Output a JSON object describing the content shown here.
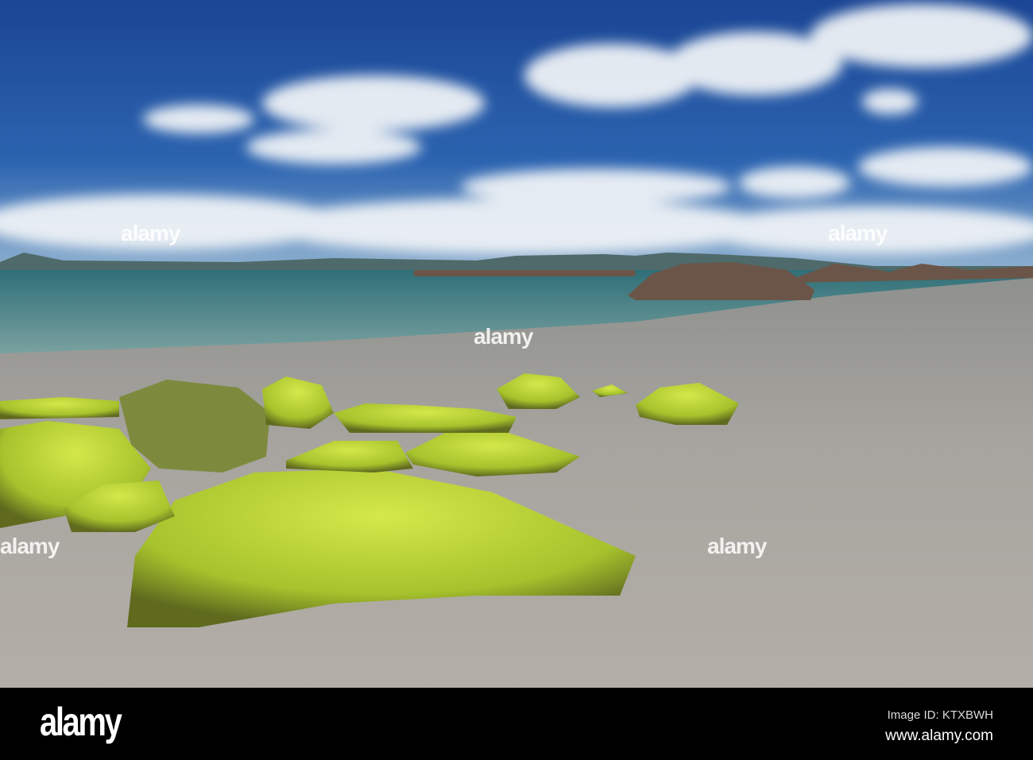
{
  "footer": {
    "logo": "alamy",
    "image_id": "Image ID: KTXBWH",
    "website": "www.alamy.com"
  },
  "watermark": "alamy",
  "colors": {
    "sky": "#1f4f9e",
    "sea": "#3f7f86",
    "sand": "#a9a59f",
    "moss": "#b5d334",
    "footer": "#000000"
  }
}
